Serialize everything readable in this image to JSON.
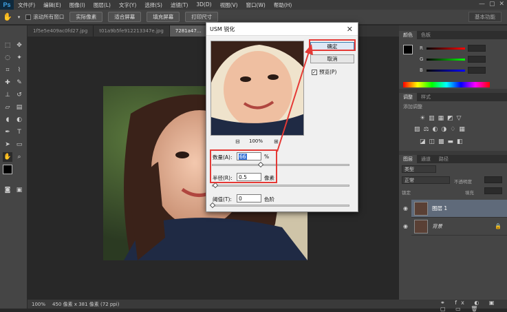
{
  "menubar": {
    "logo": "Ps",
    "items": [
      "文件(F)",
      "编辑(E)",
      "图像(I)",
      "图层(L)",
      "文字(Y)",
      "选择(S)",
      "滤镜(T)",
      "3D(D)",
      "视图(V)",
      "窗口(W)",
      "帮助(H)"
    ]
  },
  "optionsbar": {
    "scroll_all": "滚动所有窗口",
    "actual_pixels": "实际像素",
    "fit_screen": "适合屏幕",
    "fill_screen": "填充屏幕",
    "print_size": "打印尺寸",
    "workspace": "基本功能"
  },
  "tabs": [
    {
      "label": "1f5e5e409ac0fd27.jpg"
    },
    {
      "label": "t01a9b5fe912213347e.jpg"
    },
    {
      "label": "7281a47..."
    }
  ],
  "status": {
    "zoom": "100%",
    "doc_info": "450 像素 x 381 像素 (72 ppi)"
  },
  "panels": {
    "color_tabs": [
      "颜色",
      "色板"
    ],
    "color_channels": [
      "R",
      "G",
      "B"
    ],
    "adjust_tabs": [
      "调整",
      "样式"
    ],
    "adjust_label": "添加调整",
    "layer_tabs": [
      "图层",
      "通道",
      "路径"
    ],
    "kind_label": "类型",
    "blend_mode": "正常",
    "opacity_label": "不透明度",
    "lock_label": "锁定",
    "fill_label": "填充",
    "layers": [
      {
        "name": "图层 1"
      },
      {
        "name": "背景"
      }
    ]
  },
  "dialog": {
    "title": "USM 锐化",
    "ok": "确定",
    "cancel": "取消",
    "preview_label": "预览(P)",
    "zoom": "100%",
    "amount_label": "数量(A):",
    "amount_value": "66",
    "amount_unit": "%",
    "amount_level": 0.35,
    "radius_label": "半径(R):",
    "radius_value": "0.5",
    "radius_unit": "像素",
    "radius_level": 0.02,
    "threshold_label": "阈值(T):",
    "threshold_value": "0",
    "threshold_unit": "色阶",
    "threshold_level": 0.0
  },
  "colors": {
    "annotation_red": "#e53935",
    "accent_blue": "#3c7fb1"
  }
}
